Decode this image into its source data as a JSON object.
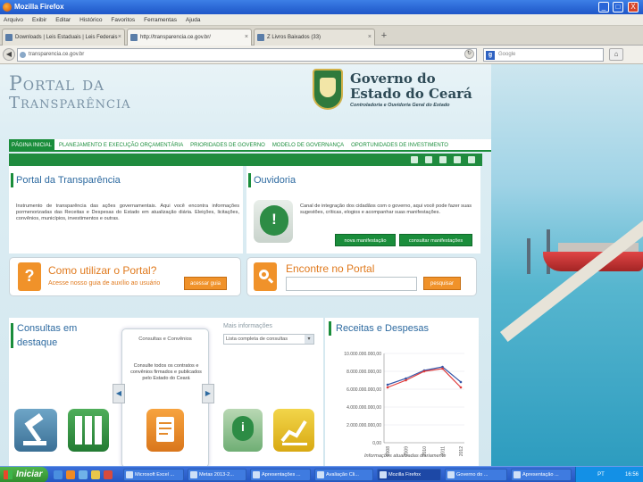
{
  "window": {
    "title": "Mozilla Firefox",
    "controls": {
      "minimize": "_",
      "maximize": "□",
      "close": "X"
    }
  },
  "menubar": [
    "Arquivo",
    "Exibir",
    "Editar",
    "Histórico",
    "Favoritos",
    "Ferramentas",
    "Ajuda"
  ],
  "tabs": [
    {
      "label": "Downloads | Leis Estaduais | Leis Federais",
      "active": false
    },
    {
      "label": "http://transparencia.ce.gov.br/",
      "active": true
    },
    {
      "label": "Z Livros Baixados (33)",
      "active": false
    }
  ],
  "newtab_label": "+",
  "navbar": {
    "url": "transparencia.ce.gov.br",
    "search_placeholder": "Google",
    "search_engine_letter": "g"
  },
  "header": {
    "portal_line1": "Portal da",
    "portal_line2": "Transparência",
    "gov_line1": "Governo do",
    "gov_line2": "Estado do Ceará",
    "gov_sub": "Controladoria e Ouvidoria Geral do Estado"
  },
  "mainnav": [
    {
      "label": "Página inicial",
      "active": true
    },
    {
      "label": "Planejamento e execução orçamentária",
      "active": false
    },
    {
      "label": "Prioridades de governo",
      "active": false
    },
    {
      "label": "Modelo de governança",
      "active": false
    },
    {
      "label": "Oportunidades de investimento",
      "active": false
    }
  ],
  "portal_panel": {
    "title": "Portal da Transparência",
    "text": "Instrumento de transparência das ações governamentais. Aqui você encontra informações pormenorizadas das Receitas e Despesas do Estado em atualização diária. Eleições, licitações, convênios, municípios, investimentos e outras."
  },
  "ouvidoria_panel": {
    "title": "Ouvidoria",
    "text": "Canal de integração dos cidadãos com o governo, aqui você pode fazer suas sugestões, críticas, elogios e acompanhar suas manifestações.",
    "btn_new": "nova manifestação",
    "btn_consult": "consultar manifestações"
  },
  "help_box": {
    "title": "Como utilizar o Portal?",
    "subtitle": "Acesse nosso guia de auxílio ao usuário",
    "button": "acessar guia",
    "icon": "?"
  },
  "search_box": {
    "title": "Encontre no Portal",
    "button": "pesquisar"
  },
  "consultas": {
    "title_line1": "Consultas em",
    "title_line2": "destaque",
    "card_title": "Consultas e Convênios",
    "card_text": "Consulte todos os contratos e convênios firmados e publicados pelo Estado do Ceará",
    "prev": "◀",
    "next": "▶",
    "filter_label": "Mais informações",
    "filter_select": "Lista completa de consultas"
  },
  "receitas": {
    "title": "Receitas e Despesas",
    "note": "Informações atualizadas diariamente",
    "legend_receitas": "Receitas",
    "legend_despesas": "Despesas"
  },
  "chart_data": {
    "type": "line",
    "title": "Receitas e Despesas",
    "x": [
      "2008",
      "2009",
      "2010",
      "2011",
      "2012"
    ],
    "yticks": [
      "10.000.000.000,00",
      "8.000.000.000,00",
      "6.000.000.000,00",
      "4.000.000.000,00",
      "2.000.000.000,00",
      "0,00"
    ],
    "ylim": [
      0,
      10000000000
    ],
    "series": [
      {
        "name": "Receitas",
        "values": [
          6500000000,
          7200000000,
          8100000000,
          8500000000,
          6800000000
        ],
        "color": "#3556a8"
      },
      {
        "name": "Despesas",
        "values": [
          6200000000,
          7000000000,
          8000000000,
          8300000000,
          6200000000
        ],
        "color": "#e03a3a"
      }
    ],
    "legend": "bottom"
  },
  "taskbar": {
    "start": "Iniciar",
    "tasks": [
      {
        "label": "Microsoft Excel ...",
        "active": false
      },
      {
        "label": "Metas 2013-2...",
        "active": false
      },
      {
        "label": "Apresentações ...",
        "active": false
      },
      {
        "label": "Avaliação Cli...",
        "active": false
      },
      {
        "label": "Mozilla Firefox",
        "active": true
      },
      {
        "label": "Governo do ...",
        "active": false
      },
      {
        "label": "Apresentação ...",
        "active": false
      }
    ],
    "tray_lang": "PT",
    "tray_time": "16:56"
  },
  "colors": {
    "brand_green": "#1a8d3b",
    "accent_orange": "#f0922a",
    "title_blue": "#2d6aa0"
  }
}
